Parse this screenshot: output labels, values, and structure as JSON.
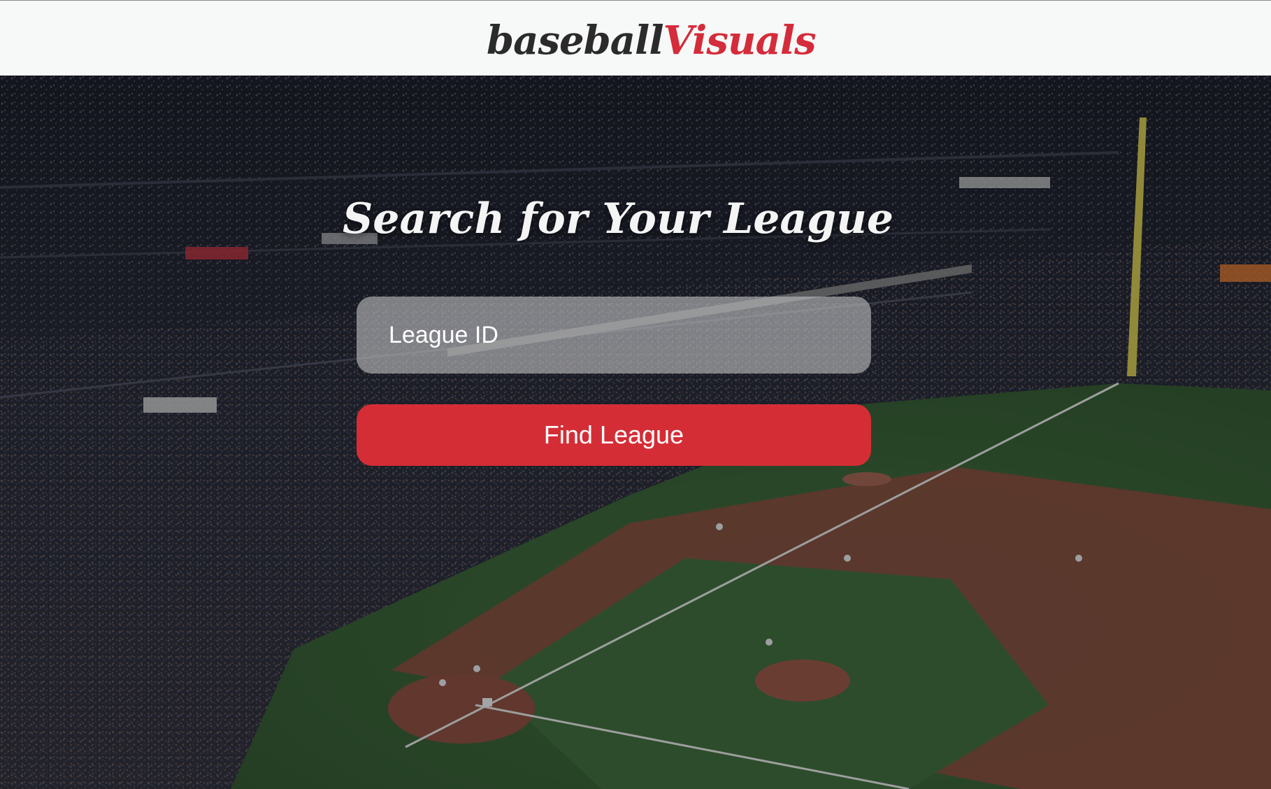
{
  "header": {
    "logo_part1": "baseball",
    "logo_part2": "Visuals"
  },
  "hero": {
    "title": "Search for Your League",
    "background": "baseball stadium photo"
  },
  "search": {
    "placeholder": "League ID",
    "value": ""
  },
  "actions": {
    "find_label": "Find League"
  },
  "colors": {
    "brand_red": "#d52d36",
    "logo_dark": "#2b2b2b",
    "header_bg": "#f7f8f8"
  }
}
